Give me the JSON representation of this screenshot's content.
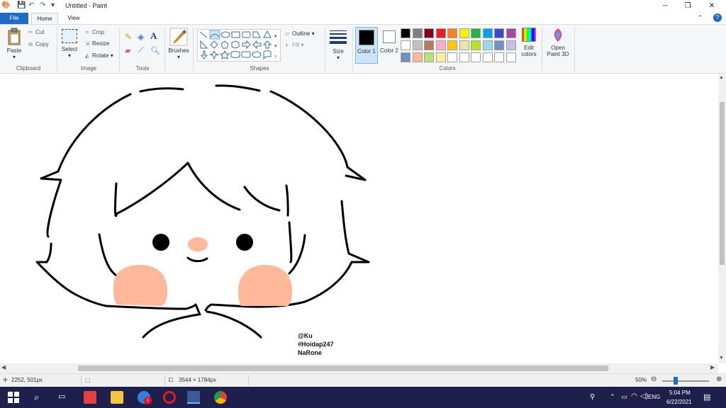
{
  "window": {
    "title": "Untitled - Paint"
  },
  "tabs": [
    "File",
    "Home",
    "View"
  ],
  "clipboard": {
    "paste": "Paste",
    "cut": "Cut",
    "copy": "Copy",
    "group": "Clipboard"
  },
  "image": {
    "select": "Select",
    "crop": "Crop",
    "resize": "Resize",
    "rotate": "Rotate",
    "group": "Image"
  },
  "tools": {
    "group": "Tools"
  },
  "brushes": {
    "label": "Brushes"
  },
  "shapes": {
    "outline": "Outline",
    "fill": "Fill",
    "group": "Shapes"
  },
  "size": {
    "label": "Size"
  },
  "colors": {
    "color1": "Color 1",
    "color2": "Color 2",
    "color1_value": "#000000",
    "color2_value": "#ffffff",
    "edit_colors": "Edit colors",
    "open_paint3d": "Open Paint 3D",
    "group": "Colors",
    "palette_row1": [
      "#000000",
      "#7f7f7f",
      "#880015",
      "#ed1c24",
      "#ff7f27",
      "#fff200",
      "#22b14c",
      "#00a2e8",
      "#3f48cc",
      "#a349a4"
    ],
    "palette_row2": [
      "#ffffff",
      "#c3c3c3",
      "#b97a57",
      "#ffaec9",
      "#ffc90e",
      "#efe4b0",
      "#b5e61d",
      "#99d9ea",
      "#7092be",
      "#c8bfe7"
    ],
    "palette_row3": [
      "#6f8fc0",
      "#ffb899",
      "#b7e27a",
      "#fff09a",
      "#ffffff",
      "#ffffff",
      "#ffffff",
      "#ffffff",
      "#ffffff",
      "#ffffff"
    ]
  },
  "drawing": {
    "credit": [
      "@Ku",
      "#Hoidap247",
      "NaRone"
    ],
    "blush_color": "#ffb899",
    "nose_color": "#ffb899"
  },
  "status": {
    "cursor_pos": "2252, 501px",
    "image_size": "3544 × 1784px",
    "zoom": "50%"
  },
  "taskbar": {
    "lang": "ENG",
    "time": "5:04 PM",
    "date": "6/22/2021",
    "notification_count": "1"
  }
}
